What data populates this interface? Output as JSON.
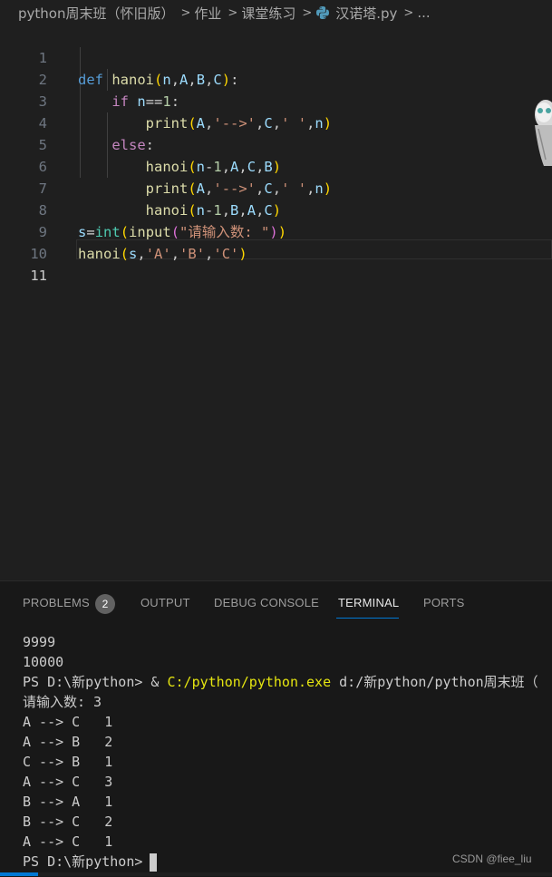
{
  "breadcrumb": {
    "folder": "python周末班（怀旧版）",
    "subfolder1": "作业",
    "subfolder2": "课堂练习",
    "file": "汉诺塔.py",
    "more": "..."
  },
  "editor": {
    "active_line": 11,
    "line_numbers": [
      "1",
      "2",
      "3",
      "4",
      "5",
      "6",
      "7",
      "8",
      "9",
      "10",
      "11"
    ]
  },
  "panel": {
    "tabs": {
      "problems": "PROBLEMS",
      "problems_count": "2",
      "output": "OUTPUT",
      "debug_console": "DEBUG CONSOLE",
      "terminal": "TERMINAL",
      "ports": "PORTS"
    },
    "terminal": {
      "line1": "9999",
      "line2": "10000",
      "prompt_cmd_prefix": "PS D:\\新python> & ",
      "prompt_cmd_exe": "C:/python/python.exe",
      "prompt_cmd_suffix": " d:/新python/python周末班（",
      "input_prompt": "请输入数: 3",
      "moves": [
        "A --> C   1",
        "A --> B   2",
        "C --> B   1",
        "A --> C   3",
        "B --> A   1",
        "B --> C   2",
        "A --> C   1"
      ],
      "final_prompt": "PS D:\\新python>"
    }
  },
  "watermark": "CSDN @fiee_liu",
  "colors": {
    "background": "#1f1f1f",
    "panel": "#181818",
    "accent": "#0078d4"
  }
}
